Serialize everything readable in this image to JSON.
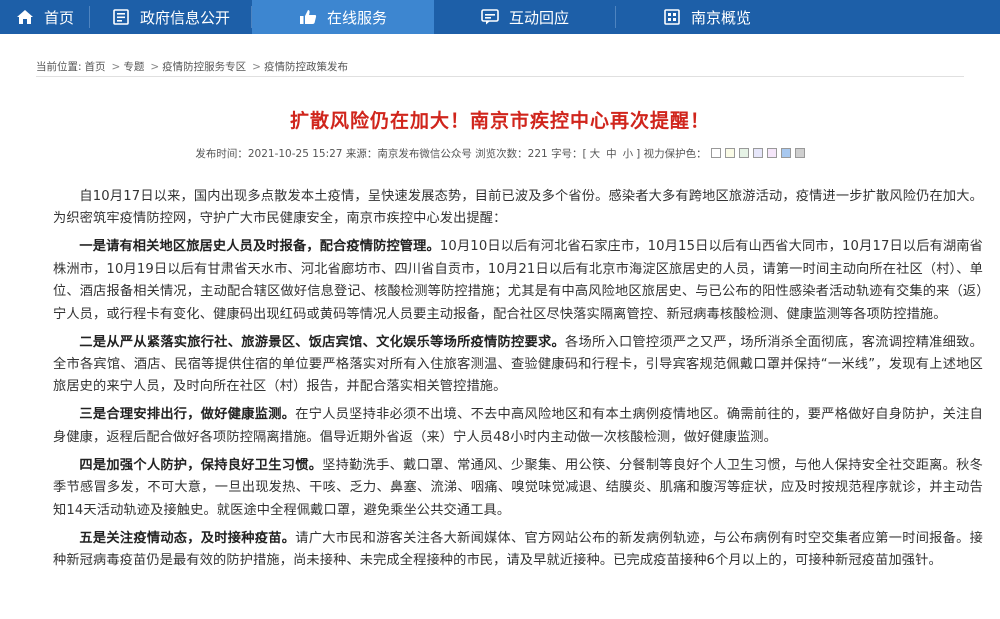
{
  "nav": {
    "items": [
      {
        "label": "首页",
        "icon": "home-icon"
      },
      {
        "label": "政府信息公开",
        "icon": "document-icon"
      },
      {
        "label": "在线服务",
        "icon": "thumbs-up-icon",
        "active": true
      },
      {
        "label": "互动回应",
        "icon": "chat-icon"
      },
      {
        "label": "南京概览",
        "icon": "building-icon"
      }
    ],
    "color": "#1d5fa8",
    "active_color": "#3d86d0"
  },
  "breadcrumb": {
    "prefix": "当前位置:",
    "items": [
      "首页",
      "专题",
      "疫情防控服务专区",
      "疫情防控政策发布"
    ],
    "separator": ">"
  },
  "article": {
    "title": "扩散风险仍在加大！南京市疾控中心再次提醒！",
    "title_color": "#d0251c",
    "meta": {
      "date": "发布时间：2021-10-25 15:27",
      "source": "来源：南京发布微信公众号",
      "views": "浏览次数：221",
      "font_label": "字号：[",
      "sizes": [
        "大",
        "中",
        "小"
      ],
      "font_close": "]",
      "eye_label": "视力保护色："
    },
    "eye_colors": [
      "#ffffff",
      "#fafbe6",
      "#e6f3e6",
      "#e6e6fa",
      "#f5e6fa",
      "#a8c8ef",
      "#cfcfcf"
    ],
    "paragraphs": [
      {
        "lead": "",
        "text": "自10月17日以来，国内出现多点散发本土疫情，呈快速发展态势，目前已波及多个省份。感染者大多有跨地区旅游活动，疫情进一步扩散风险仍在加大。为织密筑牢疫情防控网，守护广大市民健康安全，南京市疾控中心发出提醒："
      },
      {
        "lead": "一是请有相关地区旅居史人员及时报备，配合疫情防控管理。",
        "text": "10月10日以后有河北省石家庄市，10月15日以后有山西省大同市，10月17日以后有湖南省株洲市，10月19日以后有甘肃省天水市、河北省廊坊市、四川省自贡市，10月21日以后有北京市海淀区旅居史的人员，请第一时间主动向所在社区（村）、单位、酒店报备相关情况，主动配合辖区做好信息登记、核酸检测等防控措施；尤其是有中高风险地区旅居史、与已公布的阳性感染者活动轨迹有交集的来（返）宁人员，或行程卡有变化、健康码出现红码或黄码等情况人员要主动报备，配合社区尽快落实隔离管控、新冠病毒核酸检测、健康监测等各项防控措施。"
      },
      {
        "lead": "二是从严从紧落实旅行社、旅游景区、饭店宾馆、文化娱乐等场所疫情防控要求。",
        "text": "各场所入口管控须严之又严，场所消杀全面彻底，客流调控精准细致。全市各宾馆、酒店、民宿等提供住宿的单位要严格落实对所有入住旅客测温、查验健康码和行程卡，引导宾客规范佩戴口罩并保持“一米线”，发现有上述地区旅居史的来宁人员，及时向所在社区（村）报告，并配合落实相关管控措施。"
      },
      {
        "lead": "三是合理安排出行，做好健康监测。",
        "text": "在宁人员坚持非必须不出境、不去中高风险地区和有本土病例疫情地区。确需前往的，要严格做好自身防护，关注自身健康，返程后配合做好各项防控隔离措施。倡导近期外省返（来）宁人员48小时内主动做一次核酸检测，做好健康监测。"
      },
      {
        "lead": "四是加强个人防护，保持良好卫生习惯。",
        "text": "坚持勤洗手、戴口罩、常通风、少聚集、用公筷、分餐制等良好个人卫生习惯，与他人保持安全社交距离。秋冬季节感冒多发，不可大意，一旦出现发热、干咳、乏力、鼻塞、流涕、咽痛、嗅觉味觉减退、结膜炎、肌痛和腹泻等症状，应及时按规范程序就诊，并主动告知14天活动轨迹及接触史。就医途中全程佩戴口罩，避免乘坐公共交通工具。"
      },
      {
        "lead": "五是关注疫情动态，及时接种疫苗。",
        "text": "请广大市民和游客关注各大新闻媒体、官方网站公布的新发病例轨迹，与公布病例有时空交集者应第一时间报备。接种新冠病毒疫苗仍是最有效的防护措施，尚未接种、未完成全程接种的市民，请及早就近接种。已完成疫苗接种6个月以上的，可接种新冠疫苗加强针。"
      }
    ]
  }
}
